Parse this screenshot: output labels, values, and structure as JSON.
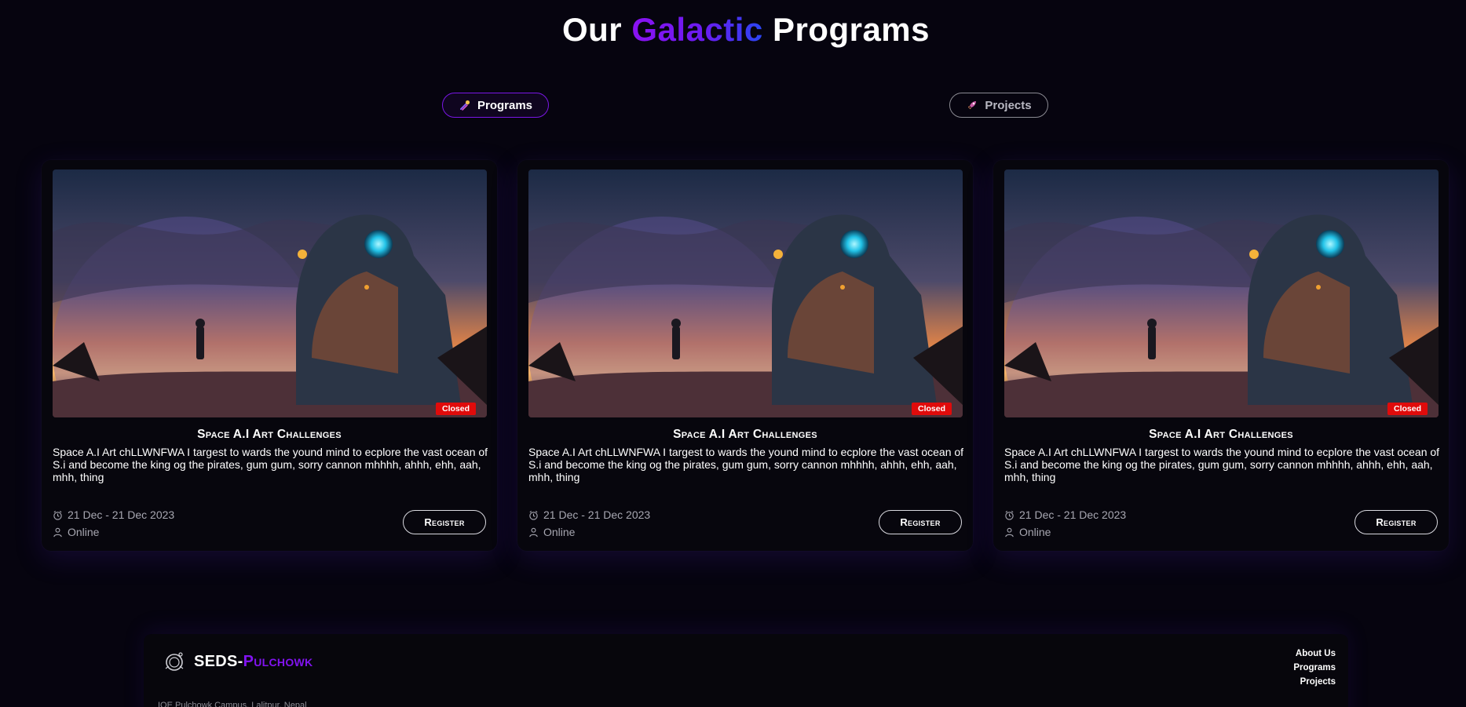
{
  "header": {
    "title_before": "Our",
    "title_highlight": "Galactic",
    "title_after": "Programs"
  },
  "tabs": [
    {
      "label": "Programs",
      "icon": "comet-icon",
      "active": true
    },
    {
      "label": "Projects",
      "icon": "rocket-icon",
      "active": false
    }
  ],
  "cards": [
    {
      "title": "Space A.I Art Challenges",
      "description": "Space A.I Art chLLWNFWA I targest to wards the yound mind to ecplore the vast ocean of S.i and become the king og the pirates, gum gum, sorry cannon mhhhh, ahhh, ehh, aah, mhh, thing",
      "status": "Closed",
      "date": "21 Dec - 21 Dec 2023",
      "location": "Online",
      "register_label": "Register"
    },
    {
      "title": "Space A.I Art Challenges",
      "description": "Space A.I Art chLLWNFWA I targest to wards the yound mind to ecplore the vast ocean of S.i and become the king og the pirates, gum gum, sorry cannon mhhhh, ahhh, ehh, aah, mhh, thing",
      "status": "Closed",
      "date": "21 Dec - 21 Dec 2023",
      "location": "Online",
      "register_label": "Register"
    },
    {
      "title": "Space A.I Art Challenges",
      "description": "Space A.I Art chLLWNFWA I targest to wards the yound mind to ecplore the vast ocean of S.i and become the king og the pirates, gum gum, sorry cannon mhhhh, ahhh, ehh, aah, mhh, thing",
      "status": "Closed",
      "date": "21 Dec - 21 Dec 2023",
      "location": "Online",
      "register_label": "Register"
    }
  ],
  "footer": {
    "brand_main": "SEDS-",
    "brand_accent": "Pulchowk",
    "address": "IOE Pulchowk Campus, Lalitpur, Nepal",
    "links": [
      "About Us",
      "Programs",
      "Projects"
    ]
  },
  "colors": {
    "background": "#06040f",
    "accent_purple": "#8113f0",
    "accent_blue": "#2a46f2",
    "status_closed": "#e00b0b"
  }
}
